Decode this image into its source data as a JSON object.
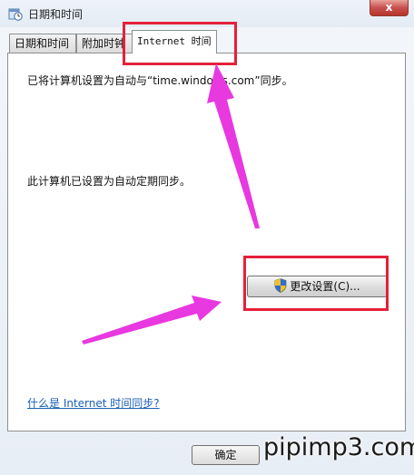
{
  "window": {
    "title": "日期和时间",
    "close_glyph": "x",
    "icon": "clock-calendar-icon"
  },
  "tabs": [
    {
      "label": "日期和时间",
      "active": false
    },
    {
      "label": "附加时钟",
      "active": false
    },
    {
      "label": "Internet 时间",
      "active": true
    }
  ],
  "panel": {
    "sync_server_text": "已将计算机设置为自动与“time.windows.com”同步。",
    "auto_sync_text": "此计算机已设置为自动定期同步。",
    "change_settings_label": "更改设置(C)...",
    "help_link": "什么是 Internet 时间同步?"
  },
  "footer": {
    "ok_label": "确定"
  },
  "watermark": "pipimp3.com",
  "colors": {
    "annotation_box": "#e5203a",
    "arrow": "#e838e0",
    "link": "#1a5fb4"
  }
}
